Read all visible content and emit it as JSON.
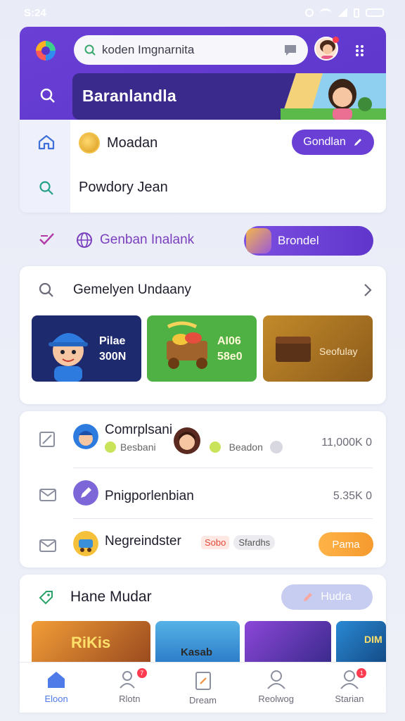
{
  "status_bar": {
    "time": "S:24"
  },
  "header": {
    "search_text": "koden Imgnarnita",
    "banner_title": "Baranlandla"
  },
  "side": {
    "row1_label": "Moadan",
    "row1_button": "Gondlan",
    "row2_label": "Powdory Jean"
  },
  "category": {
    "label": "Genban Inalank",
    "button": "Brondel"
  },
  "games": {
    "heading": "Gemelyen Undaany",
    "tiles": [
      {
        "line1": "Pilae",
        "line2": "300N"
      },
      {
        "line1": "AI06",
        "line2": "58e0"
      },
      {
        "line1": "Seofulay",
        "line2": ""
      }
    ]
  },
  "list": {
    "rows": [
      {
        "title": "Comrplsani",
        "sub1": "Besbani",
        "sub2": "Beadon",
        "right": "11,000K 0"
      },
      {
        "title": "Pnigporlenbian",
        "right": "5.35K 0"
      },
      {
        "title": "Negreindster",
        "tag1": "Sobo",
        "tag2": "Sfardhs",
        "button": "Pama"
      }
    ]
  },
  "hane": {
    "heading": "Hane Mudar",
    "button": "Hudra",
    "thumb_labels": [
      "RiKis",
      "Kasab",
      "",
      "DIM"
    ]
  },
  "nav": {
    "items": [
      {
        "label": "Eloon",
        "badge": ""
      },
      {
        "label": "Rlotn",
        "badge": "7"
      },
      {
        "label": "Dream",
        "badge": ""
      },
      {
        "label": "Reolwog",
        "badge": ""
      },
      {
        "label": "Starian",
        "badge": "1"
      }
    ]
  },
  "colors": {
    "primary": "#6a3fd6",
    "accent_orange": "#f59a2e",
    "nav_active": "#4f7be8"
  }
}
